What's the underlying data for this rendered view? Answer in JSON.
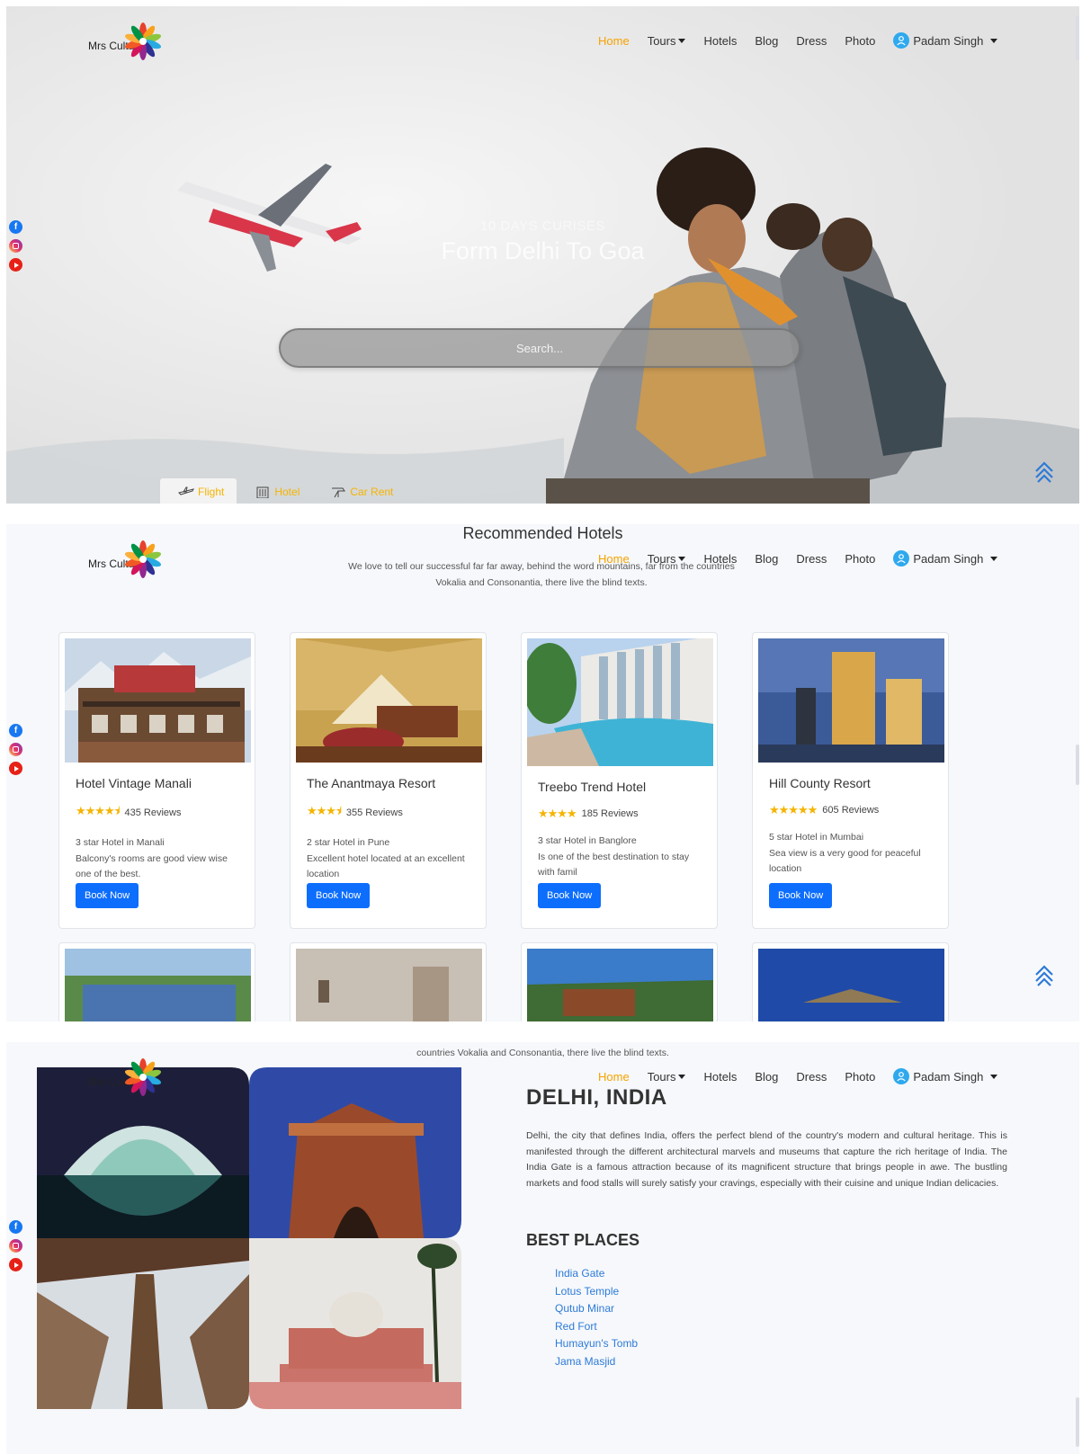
{
  "brand": {
    "name": "Mrs Culture"
  },
  "nav": {
    "items": [
      {
        "label": "Home",
        "active": true,
        "dropdown": false
      },
      {
        "label": "Tours",
        "active": false,
        "dropdown": true
      },
      {
        "label": "Hotels",
        "active": false,
        "dropdown": false
      },
      {
        "label": "Blog",
        "active": false,
        "dropdown": false
      },
      {
        "label": "Dress",
        "active": false,
        "dropdown": false
      },
      {
        "label": "Photo",
        "active": false,
        "dropdown": false
      }
    ],
    "user": "Padam Singh"
  },
  "hero": {
    "subtitle": "10 DAYS CURISES",
    "title": "Form Delhi To Goa",
    "search_placeholder": "Search...",
    "tabs": [
      "Flight",
      "Hotel",
      "Car Rent"
    ]
  },
  "recommended": {
    "title": "Recommended Hotels",
    "subtitle": "We love to tell our successful far far away, behind the word mountains, far from the countries Vokalia and Consonantia, there live the blind texts.",
    "subtitle_tail": "countries Vokalia and Consonantia, there live the blind texts.",
    "book_label": "Book Now",
    "hotels": [
      {
        "name": "Hotel Vintage Manali",
        "rating": 4.5,
        "reviews": "435 Reviews",
        "line1": "3 star Hotel in Manali",
        "line2": "Balcony's rooms are good view wise one of the best."
      },
      {
        "name": "The Anantmaya Resort",
        "rating": 3.5,
        "reviews": "355 Reviews",
        "line1": "2 star Hotel in Pune",
        "line2": "Excellent hotel located at an excellent location"
      },
      {
        "name": "Treebo Trend Hotel",
        "rating": 4,
        "reviews": "185 Reviews",
        "line1": "3 star Hotel in Banglore",
        "line2": "Is one of the best destination to stay with famil"
      },
      {
        "name": "Hill County Resort",
        "rating": 5,
        "reviews": "605 Reviews",
        "line1": "5 star Hotel in Mumbai",
        "line2": "Sea view is a very good for peaceful location"
      }
    ]
  },
  "city": {
    "title": "DELHI, INDIA",
    "description": "Delhi, the city that defines India, offers the perfect blend of the country's modern and cultural heritage. This is manifested through the different architectural marvels and museums that capture the rich heritage of India. The India Gate is a famous attraction because of its magnificent structure that brings people in awe. The bustling markets and food stalls will surely satisfy your cravings, especially with their cuisine and unique Indian delicacies.",
    "best_places_title": "BEST PLACES",
    "places": [
      "India Gate",
      "Lotus Temple",
      "Qutub Minar",
      "Red Fort",
      "Humayun's Tomb",
      "Jama Masjid"
    ]
  },
  "social": [
    "facebook-icon",
    "instagram-icon",
    "youtube-icon"
  ],
  "colors": {
    "accent": "#f5a300",
    "primary": "#0d6efd",
    "link": "#2e7ad8",
    "user_avatar": "#2fa9ee"
  }
}
